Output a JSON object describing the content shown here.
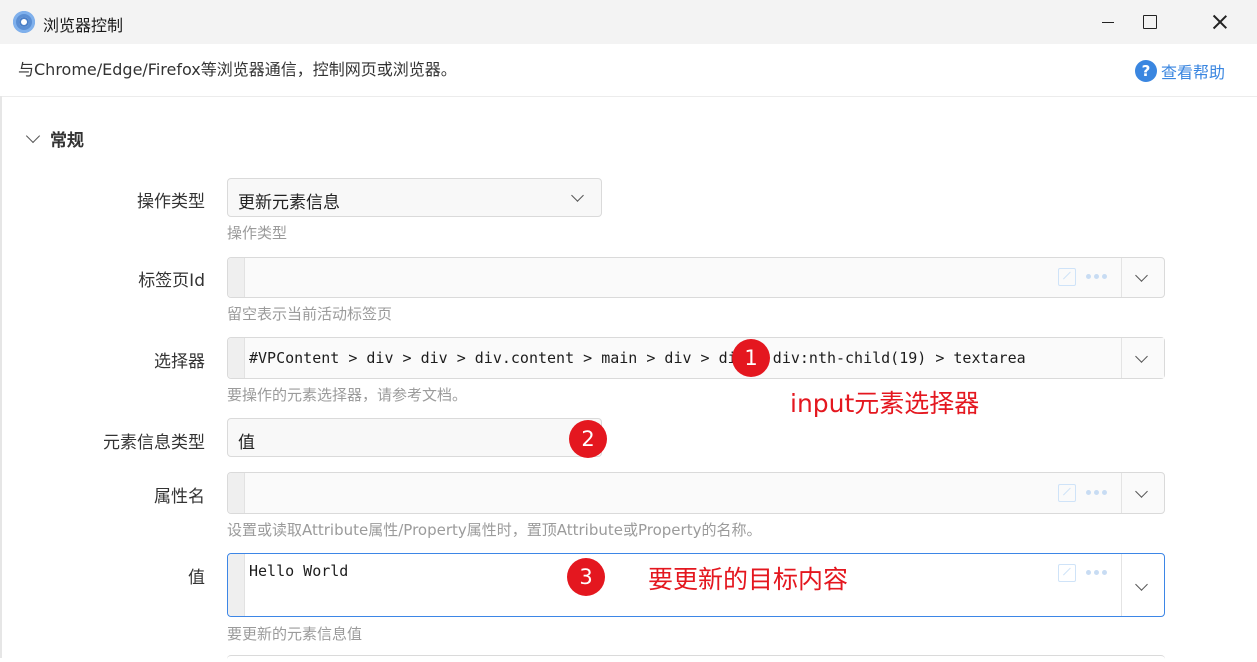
{
  "window": {
    "title": "浏览器控制"
  },
  "description": {
    "text": "与Chrome/Edge/Firefox等浏览器通信，控制网页或浏览器。",
    "help_label": "查看帮助"
  },
  "section": {
    "title": "常规"
  },
  "fields": {
    "action_type": {
      "label": "操作类型",
      "value": "更新元素信息",
      "hint": "操作类型"
    },
    "tab_id": {
      "label": "标签页Id",
      "value": "",
      "hint": "留空表示当前活动标签页"
    },
    "selector": {
      "label": "选择器",
      "value": "#VPContent > div > div > div.content > main > div > div > div:nth-child(19) > textarea",
      "hint": "要操作的元素选择器，请参考文档。"
    },
    "info_type": {
      "label": "元素信息类型",
      "value": "值"
    },
    "attr_name": {
      "label": "属性名",
      "value": "",
      "hint": "设置或读取Attribute属性/Property属性时，置顶Attribute或Property的名称。"
    },
    "value": {
      "label": "值",
      "value": "Hello World",
      "hint": "要更新的元素信息值"
    }
  },
  "annotations": {
    "badge1": "1",
    "badge2": "2",
    "badge3": "3",
    "note1": "input元素选择器",
    "note3": "要更新的目标内容"
  },
  "colors": {
    "accent": "#3a86e0",
    "annotation": "#e4171f"
  }
}
